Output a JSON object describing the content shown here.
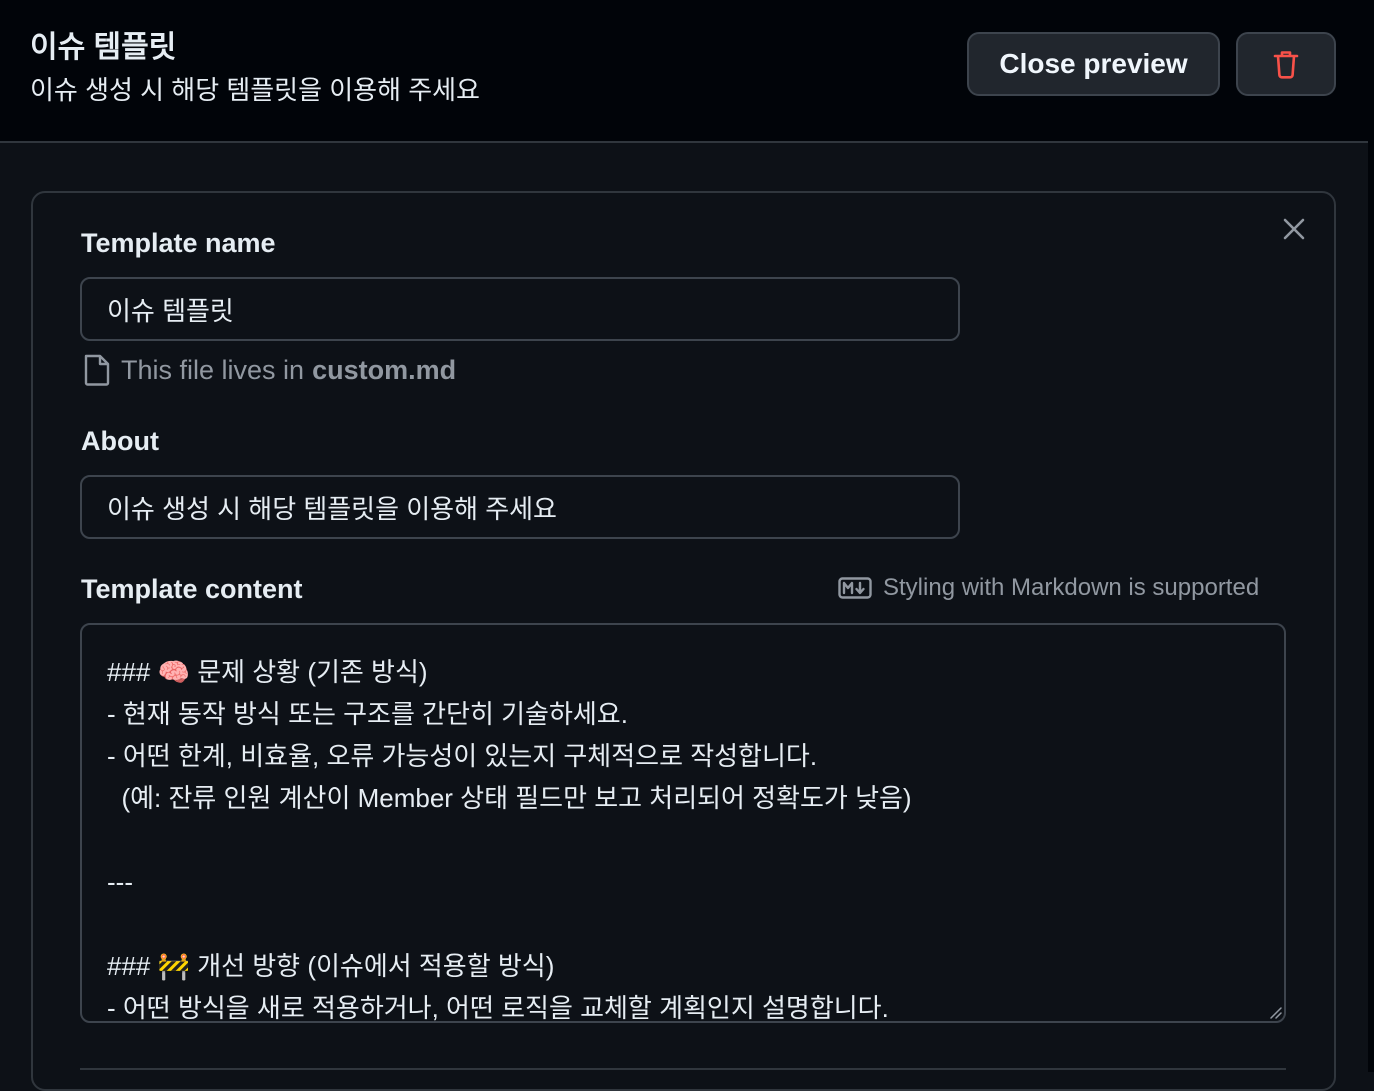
{
  "header": {
    "title": "이슈 템플릿",
    "subtitle": "이슈 생성 시 해당 템플릿을 이용해 주세요",
    "close_preview_label": "Close preview",
    "delete_icon": "trash-icon"
  },
  "form": {
    "close_icon": "close-icon",
    "name_label": "Template name",
    "name_value": "이슈 템플릿",
    "file_hint_prefix": "This file lives in",
    "file_hint_filename": "custom.md",
    "about_label": "About",
    "about_value": "이슈 생성 시 해당 템플릿을 이용해 주세요",
    "content_label": "Template content",
    "markdown_hint": "Styling with Markdown is supported",
    "content_lines": [
      "### 🧠 문제 상황 (기존 방식)",
      "- 현재 동작 방식 또는 구조를 간단히 기술하세요.",
      "- 어떤 한계, 비효율, 오류 가능성이 있는지 구체적으로 작성합니다.",
      "  (예: 잔류 인원 계산이 Member 상태 필드만 보고 처리되어 정확도가 낮음)",
      "",
      "---",
      "",
      "### 🚧 개선 방향 (이슈에서 적용할 방식)",
      "- 어떤 방식을 새로 적용하거나, 어떤 로직을 교체할 계획인지 설명합니다."
    ]
  },
  "colors": {
    "background": "#0d1117",
    "header_bg": "#010409",
    "border": "#30363d",
    "danger": "#f85149",
    "muted_text": "#9198a1"
  }
}
